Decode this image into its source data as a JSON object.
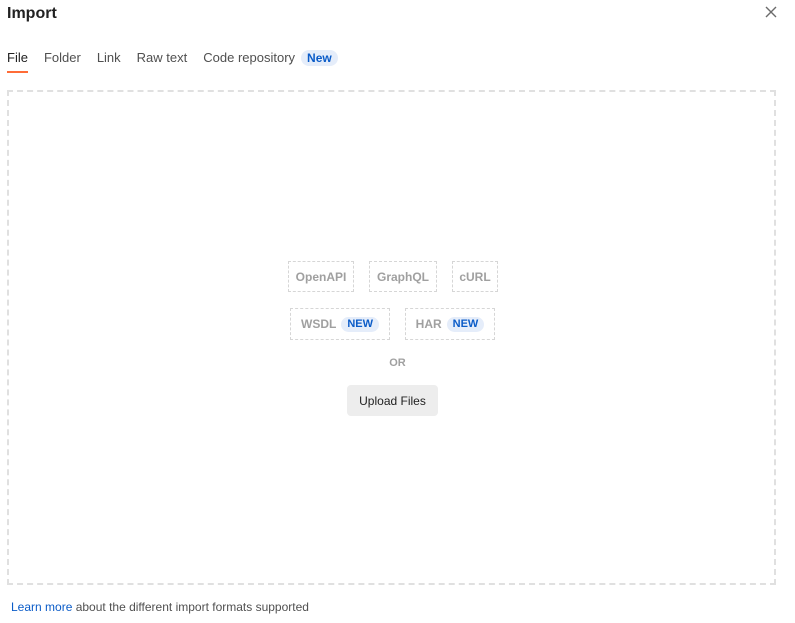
{
  "dialog": {
    "title": "Import"
  },
  "tabs": [
    {
      "label": "File",
      "active": true
    },
    {
      "label": "Folder"
    },
    {
      "label": "Link"
    },
    {
      "label": "Raw text"
    },
    {
      "label": "Code repository",
      "badge": "New"
    }
  ],
  "formats": {
    "openapi": "OpenAPI",
    "graphql": "GraphQL",
    "curl": "cURL",
    "wsdl": "WSDL",
    "wsdl_badge": "NEW",
    "har": "HAR",
    "har_badge": "NEW"
  },
  "dropzone": {
    "or_label": "OR",
    "upload_label": "Upload Files"
  },
  "footer": {
    "link_text": "Learn more",
    "rest_text": " about the different import formats supported"
  },
  "colors": {
    "accent": "#ff6c37",
    "badge_bg": "#e5edfa",
    "badge_text": "#0b5cc8"
  }
}
